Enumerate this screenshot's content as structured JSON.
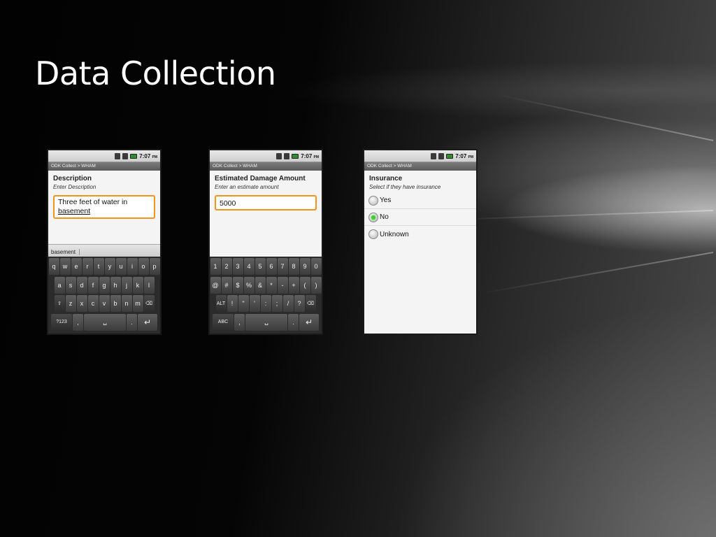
{
  "slide": {
    "title": "Data Collection"
  },
  "phones": [
    {
      "status_time": "7:07",
      "status_ampm": "PM",
      "app_title": "ODK Collect > WHAM",
      "question_label": "Description",
      "question_hint": "Enter Description",
      "answer_line1": "Three feet of water in",
      "answer_line2": "basement",
      "suggestion": "basement",
      "keys_row1": [
        "q",
        "w",
        "e",
        "r",
        "t",
        "y",
        "u",
        "i",
        "o",
        "p"
      ],
      "keys_row2": [
        "a",
        "s",
        "d",
        "f",
        "g",
        "h",
        "j",
        "k",
        "l"
      ],
      "keys_row3": [
        "⇧",
        "z",
        "x",
        "c",
        "v",
        "b",
        "n",
        "m",
        "⌫"
      ],
      "keys_row4": [
        "?123",
        ",",
        "␣",
        ".",
        "↵"
      ]
    },
    {
      "status_time": "7:07",
      "status_ampm": "PM",
      "app_title": "ODK Collect > WHAM",
      "question_label": "Estimated Damage Amount",
      "question_hint": "Enter an estimate amount",
      "answer_value": "5000",
      "keys_row1": [
        "1",
        "2",
        "3",
        "4",
        "5",
        "6",
        "7",
        "8",
        "9",
        "0"
      ],
      "keys_row2": [
        "@",
        "#",
        "$",
        "%",
        "&",
        "*",
        "-",
        "+",
        "(",
        ")"
      ],
      "keys_row3": [
        "ALT",
        "!",
        "\"",
        "'",
        ":",
        ";",
        "/",
        "?",
        "⌫"
      ],
      "keys_row4": [
        "ABC",
        ",",
        "␣",
        ".",
        "↵"
      ]
    },
    {
      "status_time": "7:07",
      "status_ampm": "PM",
      "app_title": "ODK Collect > WHAM",
      "question_label": "Insurance",
      "question_hint": "Select if they have insurance",
      "options": [
        {
          "label": "Yes",
          "selected": false
        },
        {
          "label": "No",
          "selected": true
        },
        {
          "label": "Unknown",
          "selected": false
        }
      ]
    }
  ]
}
